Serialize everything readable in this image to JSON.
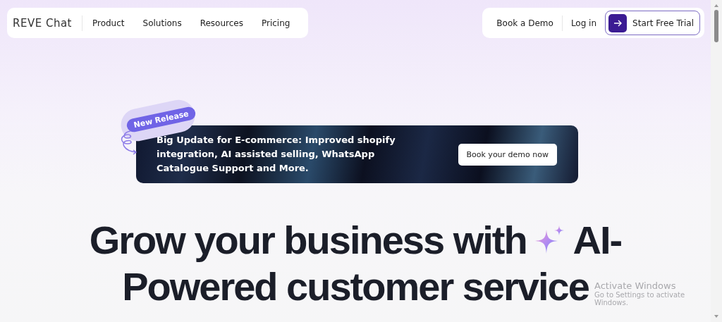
{
  "nav": {
    "logo": "REVE Chat",
    "links": [
      "Product",
      "Solutions",
      "Resources",
      "Pricing"
    ],
    "actions": [
      {
        "label": "Book a Demo",
        "kind": "link"
      },
      {
        "label": "Log in",
        "kind": "link"
      },
      {
        "label": "Start Free Trial",
        "kind": "primary"
      }
    ]
  },
  "banner": {
    "badge": "New Release",
    "text": "Big Update for E-commerce: Improved shopify integration, AI assisted selling, WhatsApp Catalogue Support and More.",
    "button": "Book your demo now"
  },
  "headline": {
    "before_icon": "Grow your business with",
    "after_icon": "AI-",
    "line_2": "Powered customer service"
  },
  "os_notice": {
    "title": "Activate Windows",
    "text": "Go to Settings to activate Windows."
  }
}
